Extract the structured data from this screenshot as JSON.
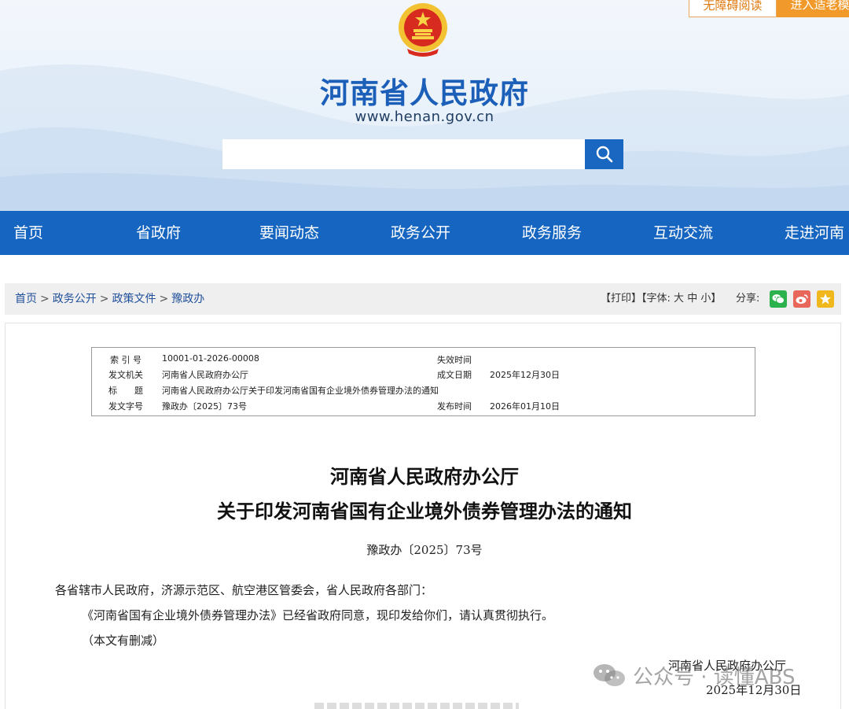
{
  "header": {
    "accessibility_label": "无障碍阅读",
    "elder_mode_label": "进入适老模",
    "site_title": "河南省人民政府",
    "site_url": "www.henan.gov.cn",
    "search_placeholder": ""
  },
  "nav": {
    "items": [
      "首页",
      "省政府",
      "要闻动态",
      "政务公开",
      "政务服务",
      "互动交流",
      "走进河南"
    ]
  },
  "breadcrumb": {
    "items": [
      "首页",
      "政务公开",
      "政策文件",
      "豫政办"
    ],
    "separator": ">"
  },
  "tools": {
    "print": "【打印】",
    "font_prefix": "【字体:",
    "font_large": "大",
    "font_medium": "中",
    "font_small": "小",
    "font_suffix": "】",
    "share_label": "分享:",
    "share_icons": [
      "wechat-icon",
      "weibo-icon",
      "favorite-icon"
    ]
  },
  "meta": {
    "index_label": "索 引 号",
    "index_value": "10001-01-2026-00008",
    "expiry_label": "失效时间",
    "expiry_value": "",
    "issuer_label": "发文机关",
    "issuer_value": "河南省人民政府办公厅",
    "created_label": "成文日期",
    "created_value": "2025年12月30日",
    "title_label": "标　　题",
    "title_value": "河南省人民政府办公厅关于印发河南省国有企业境外债券管理办法的通知",
    "docno_label": "发文字号",
    "docno_value": "豫政办〔2025〕73号",
    "published_label": "发布时间",
    "published_value": "2026年01月10日"
  },
  "document": {
    "title_line1": "河南省人民政府办公厅",
    "title_line2": "关于印发河南省国有企业境外债券管理办法的通知",
    "doc_number": "豫政办〔2025〕73号",
    "salutation": "各省辖市人民政府，济源示范区、航空港区管委会，省人民政府各部门：",
    "body": "《河南省国有企业境外债券管理办法》已经省政府同意，现印发给你们，请认真贯彻执行。",
    "note": "（本文有删减）",
    "signature_org": "河南省人民政府办公厅",
    "signature_date": "2025年12月30日"
  },
  "watermark": {
    "text": "公众号 · 读懂ABS"
  },
  "colors": {
    "brand_blue": "#1666c1",
    "title_blue": "#1c5fb8",
    "orange": "#f19a2b",
    "wechat_green": "#2bb24c",
    "weibo_red": "#e8675a",
    "favorite_yellow": "#f0b81c"
  }
}
